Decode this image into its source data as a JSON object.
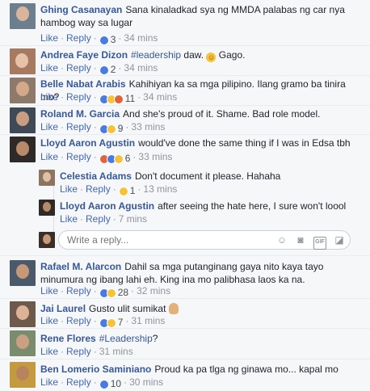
{
  "reply_placeholder": "Write a reply...",
  "labels": {
    "like": "Like",
    "reply": "Reply"
  },
  "comments": [
    {
      "author": "Ghing Casanayan",
      "text": "Sana kinaladkad sya ng MMDA palabas ng car nya hambog way sa lugar",
      "count": "3",
      "time": "34 mins",
      "reactions": [
        "like"
      ]
    },
    {
      "author": "Andrea Faye Dizon",
      "hashtag": "#leadership",
      "text": " daw. ",
      "emoji": "laughing",
      "text2": " Gago.",
      "count": "2",
      "time": "34 mins",
      "reactions": [
        "like"
      ]
    },
    {
      "author": "Belle Nabat Arabis",
      "text": "Kahihiyan ka sa mga pilipino. Ilang gramo ba tinira mo?",
      "count": "11",
      "time": "34 mins",
      "reactions": [
        "like",
        "haha",
        "angry"
      ]
    },
    {
      "author": "Roland M. Garcia",
      "text": "And she's proud of it. Shame. Bad role model.",
      "count": "9",
      "time": "33 mins",
      "reactions": [
        "like",
        "haha"
      ]
    },
    {
      "author": "Lloyd Aaron Agustin",
      "text": "would've done the same thing if I was in Edsa tbh",
      "count": "6",
      "time": "33 mins",
      "reactions": [
        "angry",
        "like",
        "haha"
      ]
    },
    {
      "author": "Celestia Adams",
      "text": "Don't document it please. Hahaha",
      "count": "1",
      "time": "13 mins",
      "reactions": [
        "haha"
      ]
    },
    {
      "author": "Lloyd Aaron Agustin",
      "text": "after seeing the hate here, I sure won't loool",
      "count": "",
      "time": "7 mins",
      "reactions": []
    },
    {
      "author": "Rafael M. Alarcon",
      "text": "Dahil sa mga putanginang gaya nito kaya tayo minumura ng ibang lahi eh. King ina mo palibhasa laos ka na.",
      "count": "28",
      "time": "32 mins",
      "reactions": [
        "like",
        "haha"
      ]
    },
    {
      "author": "Jai Laurel",
      "text": "Gusto ulit sumikat ",
      "emoji": "hand",
      "count": "7",
      "time": "31 mins",
      "reactions": [
        "like",
        "haha"
      ]
    },
    {
      "author": "Rene Flores",
      "hashtag": "#Leadership",
      "text": "?",
      "count": "",
      "time": "31 mins",
      "reactions": []
    },
    {
      "author": "Ben Lomerio Saminiano",
      "text": "Proud ka pa tlga ng ginawa mo... kapal mo",
      "count": "10",
      "time": "30 mins",
      "reactions": [
        "like"
      ]
    }
  ]
}
